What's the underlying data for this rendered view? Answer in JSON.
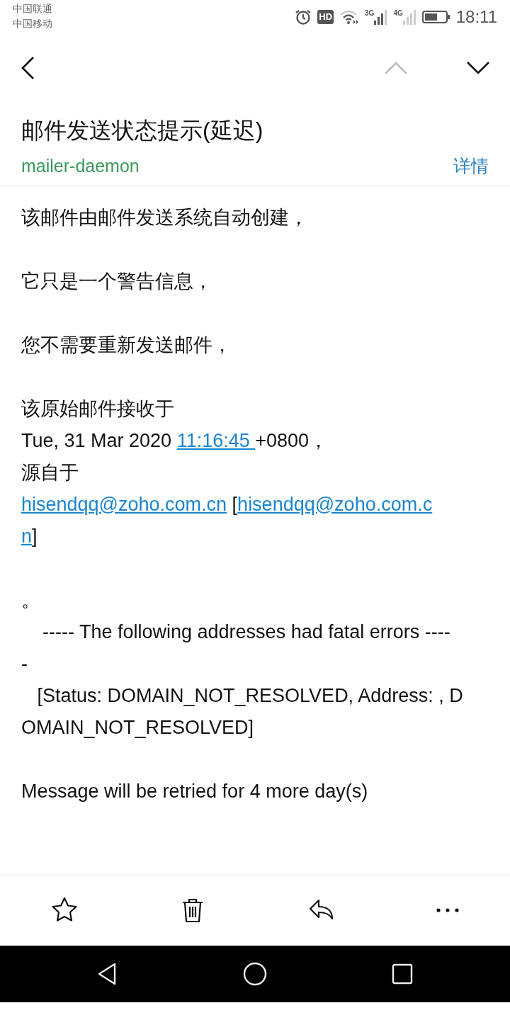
{
  "status_bar": {
    "carriers": [
      "中国联通",
      "中国移动"
    ],
    "network_labels": [
      "3G",
      "4G"
    ],
    "hd": "HD",
    "time": "18:11"
  },
  "toolbar": {
    "prev_disabled": true,
    "next_disabled": false
  },
  "email": {
    "subject": "邮件发送状态提示(延迟)",
    "sender": "mailer-daemon",
    "details": "详情",
    "paragraphs": [
      [
        [
          {
            "text": "该邮件由邮件发送系统自动创建，"
          }
        ]
      ],
      [
        [
          {
            "text": "它只是一个警告信息，"
          }
        ]
      ],
      [
        [
          {
            "text": "您不需要重新发送邮件，"
          }
        ]
      ],
      [
        [
          {
            "text": "该原始邮件接收于"
          }
        ],
        [
          {
            "text": "Tue, 31 Mar 2020 "
          },
          {
            "text": "11:16:45 ",
            "link": true
          },
          {
            "text": "+0800，"
          }
        ],
        [
          {
            "text": "源自于"
          }
        ],
        [
          {
            "text": "hisendqq@zoho.com.cn",
            "link": true
          },
          {
            "text": " ["
          },
          {
            "text": "hisendqq@zoho.com.c",
            "link": true
          }
        ],
        [
          {
            "text": "n",
            "link": true
          },
          {
            "text": "]"
          }
        ]
      ],
      [
        [
          {
            "text": "。"
          }
        ],
        [
          {
            "text": "    ----- The following addresses had fatal errors ----"
          }
        ],
        [
          {
            "text": "-"
          }
        ],
        [
          {
            "text": "   [Status: DOMAIN_NOT_RESOLVED, Address: , D"
          }
        ],
        [
          {
            "text": "OMAIN_NOT_RESOLVED]"
          }
        ]
      ],
      [
        [
          {
            "text": "Message will be retried for 4 more day(s)"
          }
        ]
      ]
    ]
  },
  "actions": [
    {
      "kind": "star"
    },
    {
      "kind": "delete"
    },
    {
      "kind": "reply"
    },
    {
      "kind": "more"
    }
  ],
  "nav_bar": [
    {
      "kind": "back"
    },
    {
      "kind": "home"
    },
    {
      "kind": "recents"
    }
  ]
}
